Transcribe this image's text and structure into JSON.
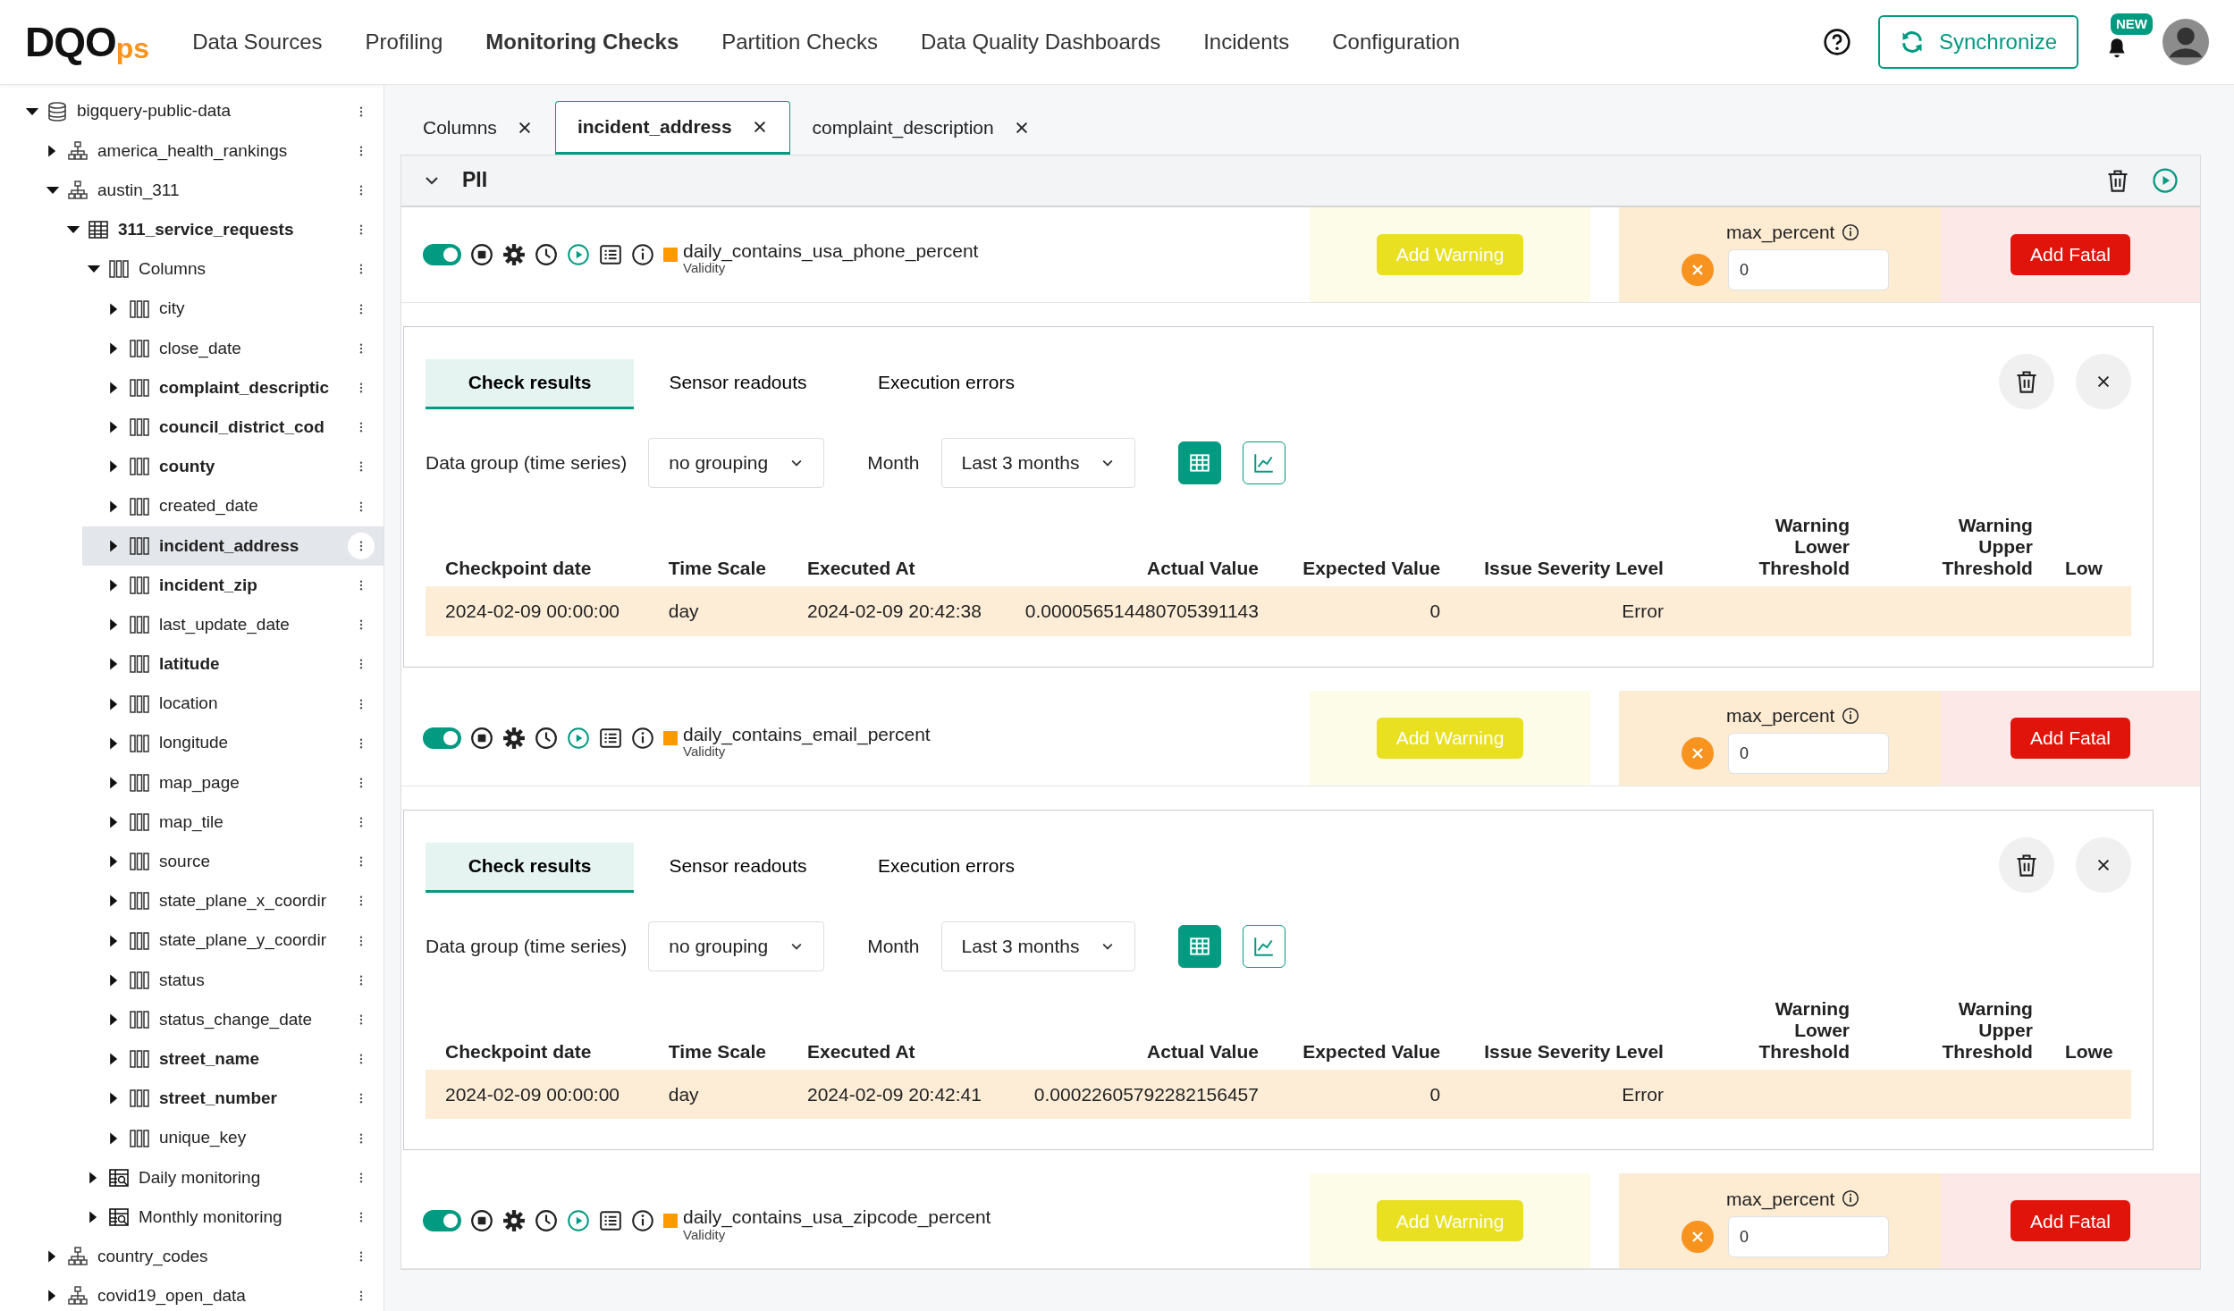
{
  "logo": {
    "main": "DQO",
    "suffix": "ps"
  },
  "nav": [
    {
      "label": "Data Sources",
      "selected": false
    },
    {
      "label": "Profiling",
      "selected": false
    },
    {
      "label": "Monitoring Checks",
      "selected": true
    },
    {
      "label": "Partition Checks",
      "selected": false
    },
    {
      "label": "Data Quality Dashboards",
      "selected": false
    },
    {
      "label": "Incidents",
      "selected": false
    },
    {
      "label": "Configuration",
      "selected": false
    }
  ],
  "header_actions": {
    "sync_label": "Synchronize",
    "notification_badge": "NEW"
  },
  "tree": [
    {
      "label": "bigquery-public-data",
      "kind": "database",
      "expanded": true,
      "highlighted": false,
      "selected": false,
      "children": [
        {
          "label": "america_health_rankings",
          "kind": "schema",
          "expanded": false,
          "highlighted": false,
          "selected": false
        },
        {
          "label": "austin_311",
          "kind": "schema",
          "expanded": true,
          "highlighted": false,
          "selected": false,
          "children": [
            {
              "label": "311_service_requests",
              "kind": "table",
              "expanded": true,
              "highlighted": true,
              "selected": false,
              "children": [
                {
                  "label": "Columns",
                  "kind": "folder",
                  "expanded": true,
                  "highlighted": false,
                  "selected": false,
                  "children": [
                    {
                      "label": "city",
                      "kind": "column",
                      "expanded": false,
                      "highlighted": false,
                      "selected": false
                    },
                    {
                      "label": "close_date",
                      "kind": "column",
                      "expanded": false,
                      "highlighted": false,
                      "selected": false
                    },
                    {
                      "label": "complaint_descriptic",
                      "kind": "column",
                      "expanded": false,
                      "highlighted": true,
                      "selected": false
                    },
                    {
                      "label": "council_district_cod",
                      "kind": "column",
                      "expanded": false,
                      "highlighted": true,
                      "selected": false
                    },
                    {
                      "label": "county",
                      "kind": "column",
                      "expanded": false,
                      "highlighted": true,
                      "selected": false
                    },
                    {
                      "label": "created_date",
                      "kind": "column",
                      "expanded": false,
                      "highlighted": false,
                      "selected": false
                    },
                    {
                      "label": "incident_address",
                      "kind": "column",
                      "expanded": false,
                      "highlighted": true,
                      "selected": true
                    },
                    {
                      "label": "incident_zip",
                      "kind": "column",
                      "expanded": false,
                      "highlighted": true,
                      "selected": false
                    },
                    {
                      "label": "last_update_date",
                      "kind": "column",
                      "expanded": false,
                      "highlighted": false,
                      "selected": false
                    },
                    {
                      "label": "latitude",
                      "kind": "column",
                      "expanded": false,
                      "highlighted": true,
                      "selected": false
                    },
                    {
                      "label": "location",
                      "kind": "column",
                      "expanded": false,
                      "highlighted": false,
                      "selected": false
                    },
                    {
                      "label": "longitude",
                      "kind": "column",
                      "expanded": false,
                      "highlighted": false,
                      "selected": false
                    },
                    {
                      "label": "map_page",
                      "kind": "column",
                      "expanded": false,
                      "highlighted": false,
                      "selected": false
                    },
                    {
                      "label": "map_tile",
                      "kind": "column",
                      "expanded": false,
                      "highlighted": false,
                      "selected": false
                    },
                    {
                      "label": "source",
                      "kind": "column",
                      "expanded": false,
                      "highlighted": false,
                      "selected": false
                    },
                    {
                      "label": "state_plane_x_coordir",
                      "kind": "column",
                      "expanded": false,
                      "highlighted": false,
                      "selected": false
                    },
                    {
                      "label": "state_plane_y_coordir",
                      "kind": "column",
                      "expanded": false,
                      "highlighted": false,
                      "selected": false
                    },
                    {
                      "label": "status",
                      "kind": "column",
                      "expanded": false,
                      "highlighted": false,
                      "selected": false
                    },
                    {
                      "label": "status_change_date",
                      "kind": "column",
                      "expanded": false,
                      "highlighted": false,
                      "selected": false
                    },
                    {
                      "label": "street_name",
                      "kind": "column",
                      "expanded": false,
                      "highlighted": true,
                      "selected": false
                    },
                    {
                      "label": "street_number",
                      "kind": "column",
                      "expanded": false,
                      "highlighted": true,
                      "selected": false
                    },
                    {
                      "label": "unique_key",
                      "kind": "column",
                      "expanded": false,
                      "highlighted": false,
                      "selected": false
                    }
                  ]
                },
                {
                  "label": "Daily monitoring",
                  "kind": "monitoring",
                  "expanded": false,
                  "highlighted": false,
                  "selected": false
                },
                {
                  "label": "Monthly monitoring",
                  "kind": "monitoring",
                  "expanded": false,
                  "highlighted": false,
                  "selected": false
                }
              ]
            }
          ]
        },
        {
          "label": "country_codes",
          "kind": "schema",
          "expanded": false,
          "highlighted": false,
          "selected": false
        },
        {
          "label": "covid19_open_data",
          "kind": "schema",
          "expanded": false,
          "highlighted": false,
          "selected": false
        }
      ]
    }
  ],
  "tabs": [
    {
      "label": "Columns",
      "selected": false
    },
    {
      "label": "incident_address",
      "selected": true
    },
    {
      "label": "complaint_description",
      "selected": false
    }
  ],
  "category": {
    "name": "PII",
    "expanded": true
  },
  "checks": [
    {
      "name": "daily_contains_usa_phone_percent",
      "group": "Validity",
      "enabled": true,
      "warning_button": "Add Warning",
      "error_param": "max_percent",
      "error_value": "0",
      "fatal_button": "Add Fatal",
      "results": {
        "tabs": [
          {
            "label": "Check results",
            "selected": true
          },
          {
            "label": "Sensor readouts",
            "selected": false
          },
          {
            "label": "Execution errors",
            "selected": false
          }
        ],
        "group_label": "Data group (time series)",
        "group_value": "no grouping",
        "month_label": "Month",
        "month_value": "Last 3 months",
        "views": [
          {
            "kind": "table",
            "selected": true
          },
          {
            "kind": "chart",
            "selected": false
          }
        ],
        "columns": [
          "Checkpoint date",
          "Time Scale",
          "Executed At",
          "Actual Value",
          "Expected Value",
          "Issue Severity Level",
          "Warning\nLower Threshold",
          "Warning\nUpper Threshold",
          "Low"
        ],
        "rows": [
          [
            "2024-02-09 00:00:00",
            "day",
            "2024-02-09 20:42:38",
            "0.000056514480705391143",
            "0",
            "Error"
          ]
        ]
      }
    },
    {
      "name": "daily_contains_email_percent",
      "group": "Validity",
      "enabled": true,
      "warning_button": "Add Warning",
      "error_param": "max_percent",
      "error_value": "0",
      "fatal_button": "Add Fatal",
      "results": {
        "tabs": [
          {
            "label": "Check results",
            "selected": true
          },
          {
            "label": "Sensor readouts",
            "selected": false
          },
          {
            "label": "Execution errors",
            "selected": false
          }
        ],
        "group_label": "Data group (time series)",
        "group_value": "no grouping",
        "month_label": "Month",
        "month_value": "Last 3 months",
        "views": [
          {
            "kind": "table",
            "selected": true
          },
          {
            "kind": "chart",
            "selected": false
          }
        ],
        "columns": [
          "Checkpoint date",
          "Time Scale",
          "Executed At",
          "Actual Value",
          "Expected Value",
          "Issue Severity Level",
          "Warning\nLower Threshold",
          "Warning\nUpper Threshold",
          "Lowe"
        ],
        "rows": [
          [
            "2024-02-09 00:00:00",
            "day",
            "2024-02-09 20:42:41",
            "0.00022605792282156457",
            "0",
            "Error"
          ]
        ]
      }
    },
    {
      "name": "daily_contains_usa_zipcode_percent",
      "group": "Validity",
      "enabled": true,
      "warning_button": "Add Warning",
      "error_param": "max_percent",
      "error_value": "0",
      "fatal_button": "Add Fatal"
    }
  ]
}
